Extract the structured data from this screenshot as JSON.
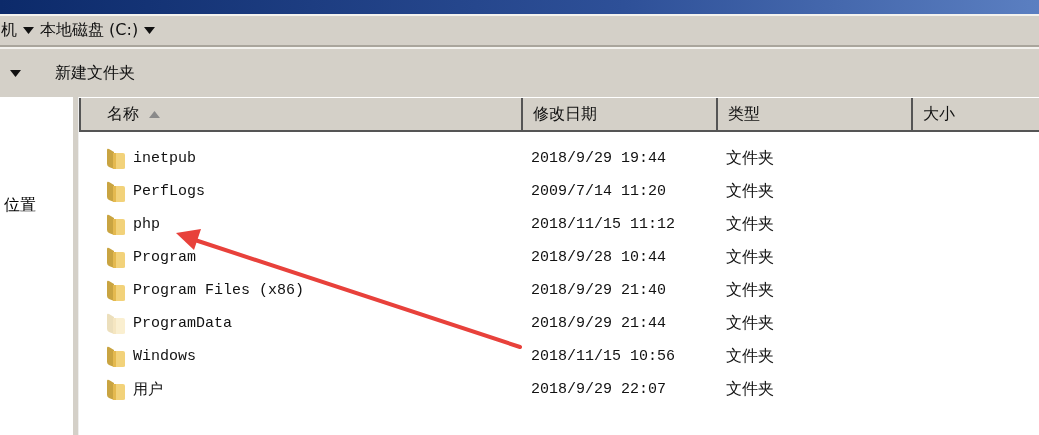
{
  "breadcrumb": {
    "items": [
      "机",
      "本地磁盘 (C:)"
    ]
  },
  "toolbar": {
    "buttons": [
      "新建文件夹"
    ]
  },
  "nav_pane": {
    "items": [
      "位置"
    ]
  },
  "table": {
    "columns": [
      {
        "label": "名称",
        "sorted": true
      },
      {
        "label": "修改日期",
        "sorted": false
      },
      {
        "label": "类型",
        "sorted": false
      },
      {
        "label": "大小",
        "sorted": false
      }
    ],
    "rows": [
      {
        "name": "inetpub",
        "modified": "2018/9/29 19:44",
        "type": "文件夹",
        "hidden": false
      },
      {
        "name": "PerfLogs",
        "modified": "2009/7/14 11:20",
        "type": "文件夹",
        "hidden": false
      },
      {
        "name": "php",
        "modified": "2018/11/15 11:12",
        "type": "文件夹",
        "hidden": false
      },
      {
        "name": "Program",
        "modified": "2018/9/28 10:44",
        "type": "文件夹",
        "hidden": false
      },
      {
        "name": "Program Files (x86)",
        "modified": "2018/9/29 21:40",
        "type": "文件夹",
        "hidden": false
      },
      {
        "name": "ProgramData",
        "modified": "2018/9/29 21:44",
        "type": "文件夹",
        "hidden": true
      },
      {
        "name": "Windows",
        "modified": "2018/11/15 10:56",
        "type": "文件夹",
        "hidden": false
      },
      {
        "name": "用户",
        "modified": "2018/9/29 22:07",
        "type": "文件夹",
        "hidden": false
      }
    ]
  },
  "annotation": {
    "kind": "arrow"
  }
}
